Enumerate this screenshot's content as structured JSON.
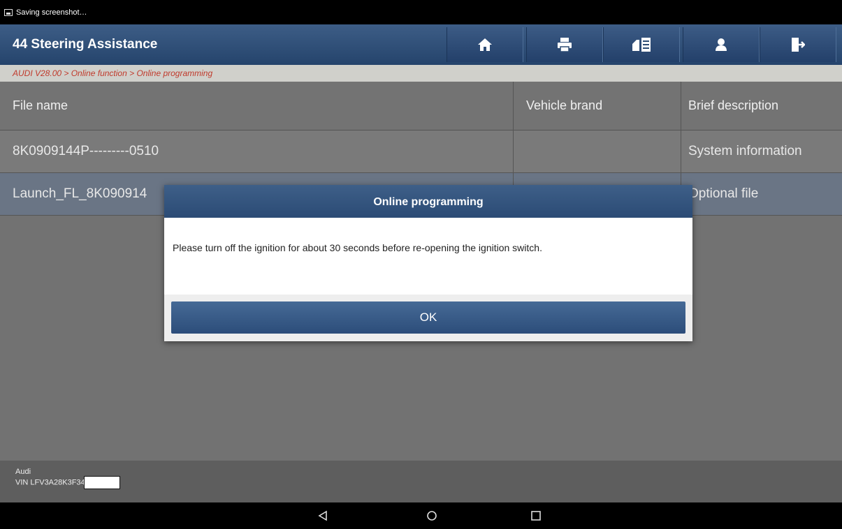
{
  "status_bar": {
    "text": "Saving screenshot…"
  },
  "header": {
    "title": "44 Steering Assistance",
    "toolbar": [
      {
        "icon": "home-icon"
      },
      {
        "icon": "print-icon"
      },
      {
        "icon": "report-icon"
      },
      {
        "icon": "user-icon"
      },
      {
        "icon": "exit-icon"
      }
    ]
  },
  "breadcrumb": "AUDI V28.00 > Online function > Online programming",
  "table": {
    "columns": [
      "File name",
      "Vehicle brand",
      "Brief description"
    ],
    "rows": [
      {
        "file": "8K0909144P---------0510",
        "brand": "",
        "desc": "System information"
      },
      {
        "file": "Launch_FL_8K090914",
        "brand": "",
        "desc": "Optional file"
      }
    ]
  },
  "footer": {
    "make": "Audi",
    "vin": "VIN LFV3A28K3F34"
  },
  "dialog": {
    "title": "Online programming",
    "message": "Please turn off the ignition for about 30 seconds before re-opening the ignition switch.",
    "ok_label": "OK"
  },
  "colors": {
    "header": "#2d4c74",
    "breadcrumb_text": "#c0392b",
    "selected_row": "#6a7585"
  }
}
